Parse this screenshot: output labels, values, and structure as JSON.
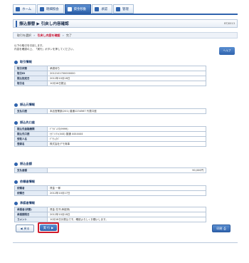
{
  "nav": {
    "tabs": [
      {
        "label": "ホーム",
        "icon": "home-icon",
        "active": false
      },
      {
        "label": "明細照会",
        "icon": "list-icon",
        "active": false
      },
      {
        "label": "資金移動",
        "icon": "transfer-icon",
        "active": true
      },
      {
        "label": "承認",
        "icon": "check-icon",
        "active": false
      },
      {
        "label": "管理",
        "icon": "gear-icon",
        "active": false
      }
    ]
  },
  "title": {
    "text": "振込振替 ▶ 引戻し内容確認",
    "screen_id": "BTJS013"
  },
  "steps": [
    "取引を選択",
    "引戻し内容を確認",
    "完了"
  ],
  "intro": [
    "以下の取引を引戻します。",
    "内容を確認の上、「実行」ボタンを押してください。"
  ],
  "help_label": "ヘルプ",
  "sections": {
    "torihiki": {
      "heading": "取引情報",
      "rows": [
        {
          "label": "取引状態",
          "value": "承認待ち"
        },
        {
          "label": "取引ID",
          "value": "2012101700000000"
        },
        {
          "label": "振込指定日",
          "value": "2012年10月18日"
        },
        {
          "label": "取引名",
          "value": "10月18日振込"
        }
      ]
    },
    "motokoza": {
      "heading": "振込元情報",
      "rows": [
        {
          "label": "支払口座",
          "value": "本店営業部(201) 普通1234567 代表口座"
        }
      ]
    },
    "sakikoza": {
      "heading": "振込先口座",
      "rows": [
        {
          "label": "振込先金融機関",
          "value": "ﾃﾞﾓｷﾞﾝｺｳ(9999)"
        },
        {
          "label": "振込先口座",
          "value": "ﾋｶﾞｼｼﾃﾝ(444) 普通 4444444"
        },
        {
          "label": "受取人名",
          "value": "ﾃﾞﾓｼｮｳｼﾞ"
        },
        {
          "label": "登録名",
          "value": "株式会社デモ商事"
        }
      ]
    },
    "kingaku": {
      "heading": "振込金額",
      "rows": [
        {
          "label": "支払金額",
          "value": "90,000円"
        }
      ]
    },
    "irai": {
      "heading": "依頼者情報",
      "rows": [
        {
          "label": "依頼者",
          "value": "資金 一郎"
        },
        {
          "label": "依頼日",
          "value": "2012年10月17日"
        }
      ]
    },
    "shonin": {
      "heading": "承認者情報",
      "rows": [
        {
          "label": "承認者(状態)",
          "value": "資金 花子(承認済)"
        },
        {
          "label": "承認期限日",
          "value": "2012年10月18日"
        },
        {
          "label": "コメント",
          "value": "10月18日分振込です。確認よろしくお願いします。"
        }
      ]
    }
  },
  "buttons": {
    "back": "戻る",
    "execute": "実 行",
    "print": "印刷"
  }
}
